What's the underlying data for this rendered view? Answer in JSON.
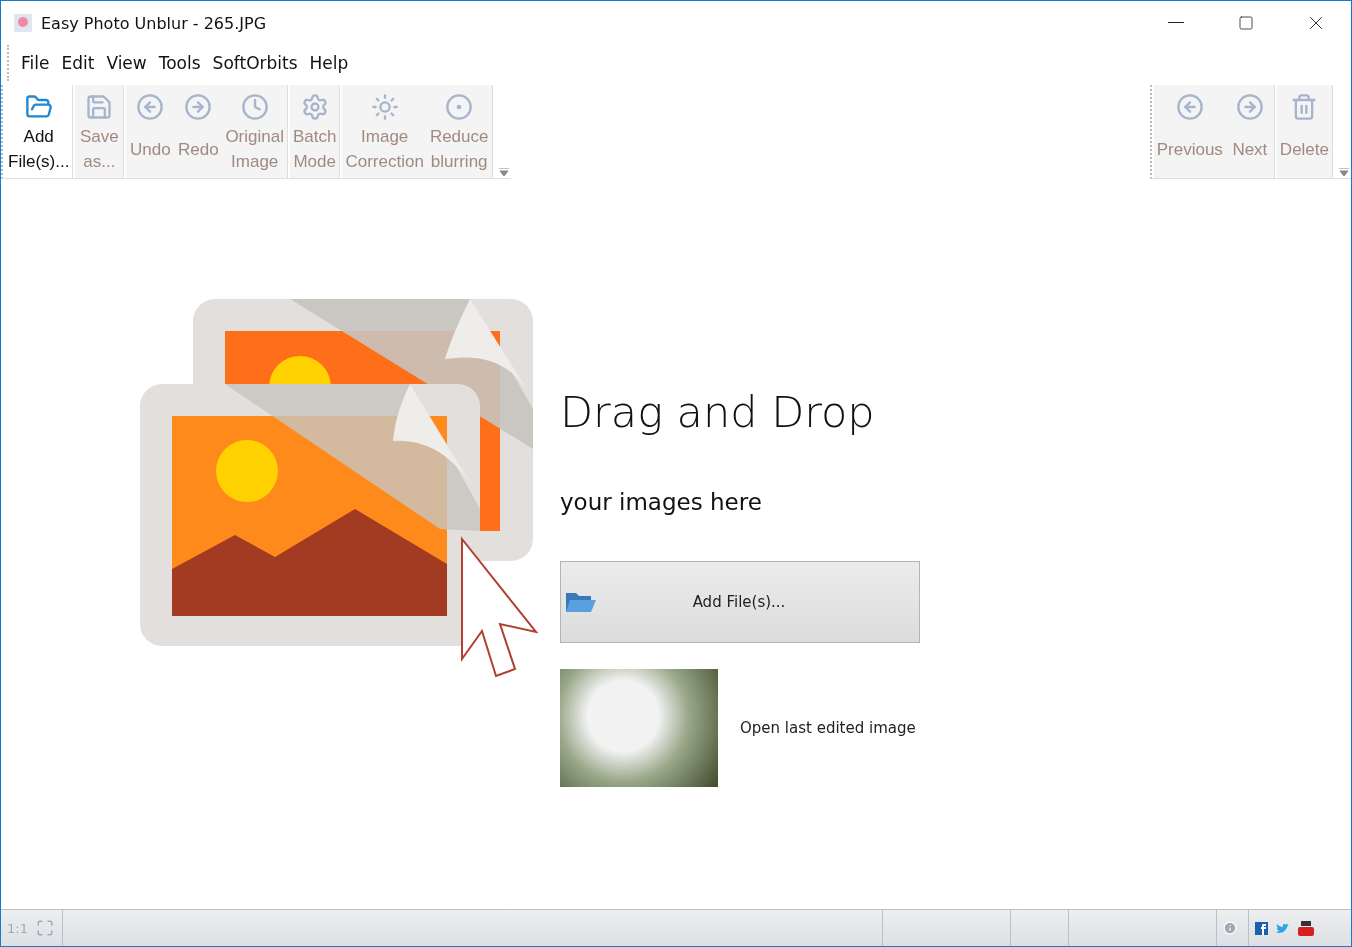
{
  "window": {
    "title": "Easy Photo Unblur - 265.JPG"
  },
  "menu": [
    "File",
    "Edit",
    "View",
    "Tools",
    "SoftOrbits",
    "Help"
  ],
  "toolbar_left": [
    {
      "items": [
        {
          "label": "Add\nFile(s)...",
          "disabled": false
        }
      ]
    },
    {
      "items": [
        {
          "label": "Save\nas...",
          "disabled": true
        }
      ]
    },
    {
      "items": [
        {
          "label": "Undo",
          "disabled": true
        },
        {
          "label": "Redo",
          "disabled": true
        },
        {
          "label": "Original\nImage",
          "disabled": true
        }
      ]
    },
    {
      "items": [
        {
          "label": "Batch\nMode",
          "disabled": true
        }
      ]
    },
    {
      "items": [
        {
          "label": "Image\nCorrection",
          "disabled": true
        },
        {
          "label": "Reduce\nblurring",
          "disabled": true
        }
      ]
    }
  ],
  "toolbar_right": [
    {
      "items": [
        {
          "label": "Previous",
          "disabled": true
        },
        {
          "label": "Next",
          "disabled": true
        }
      ]
    },
    {
      "items": [
        {
          "label": "Delete",
          "disabled": true
        }
      ]
    }
  ],
  "drop_zone": {
    "heading": "Drag and Drop",
    "subheading": "your images here",
    "button": "Add File(s)...",
    "last_image_label": "Open last edited image"
  },
  "status_bar": {
    "zoom": "1:1"
  }
}
